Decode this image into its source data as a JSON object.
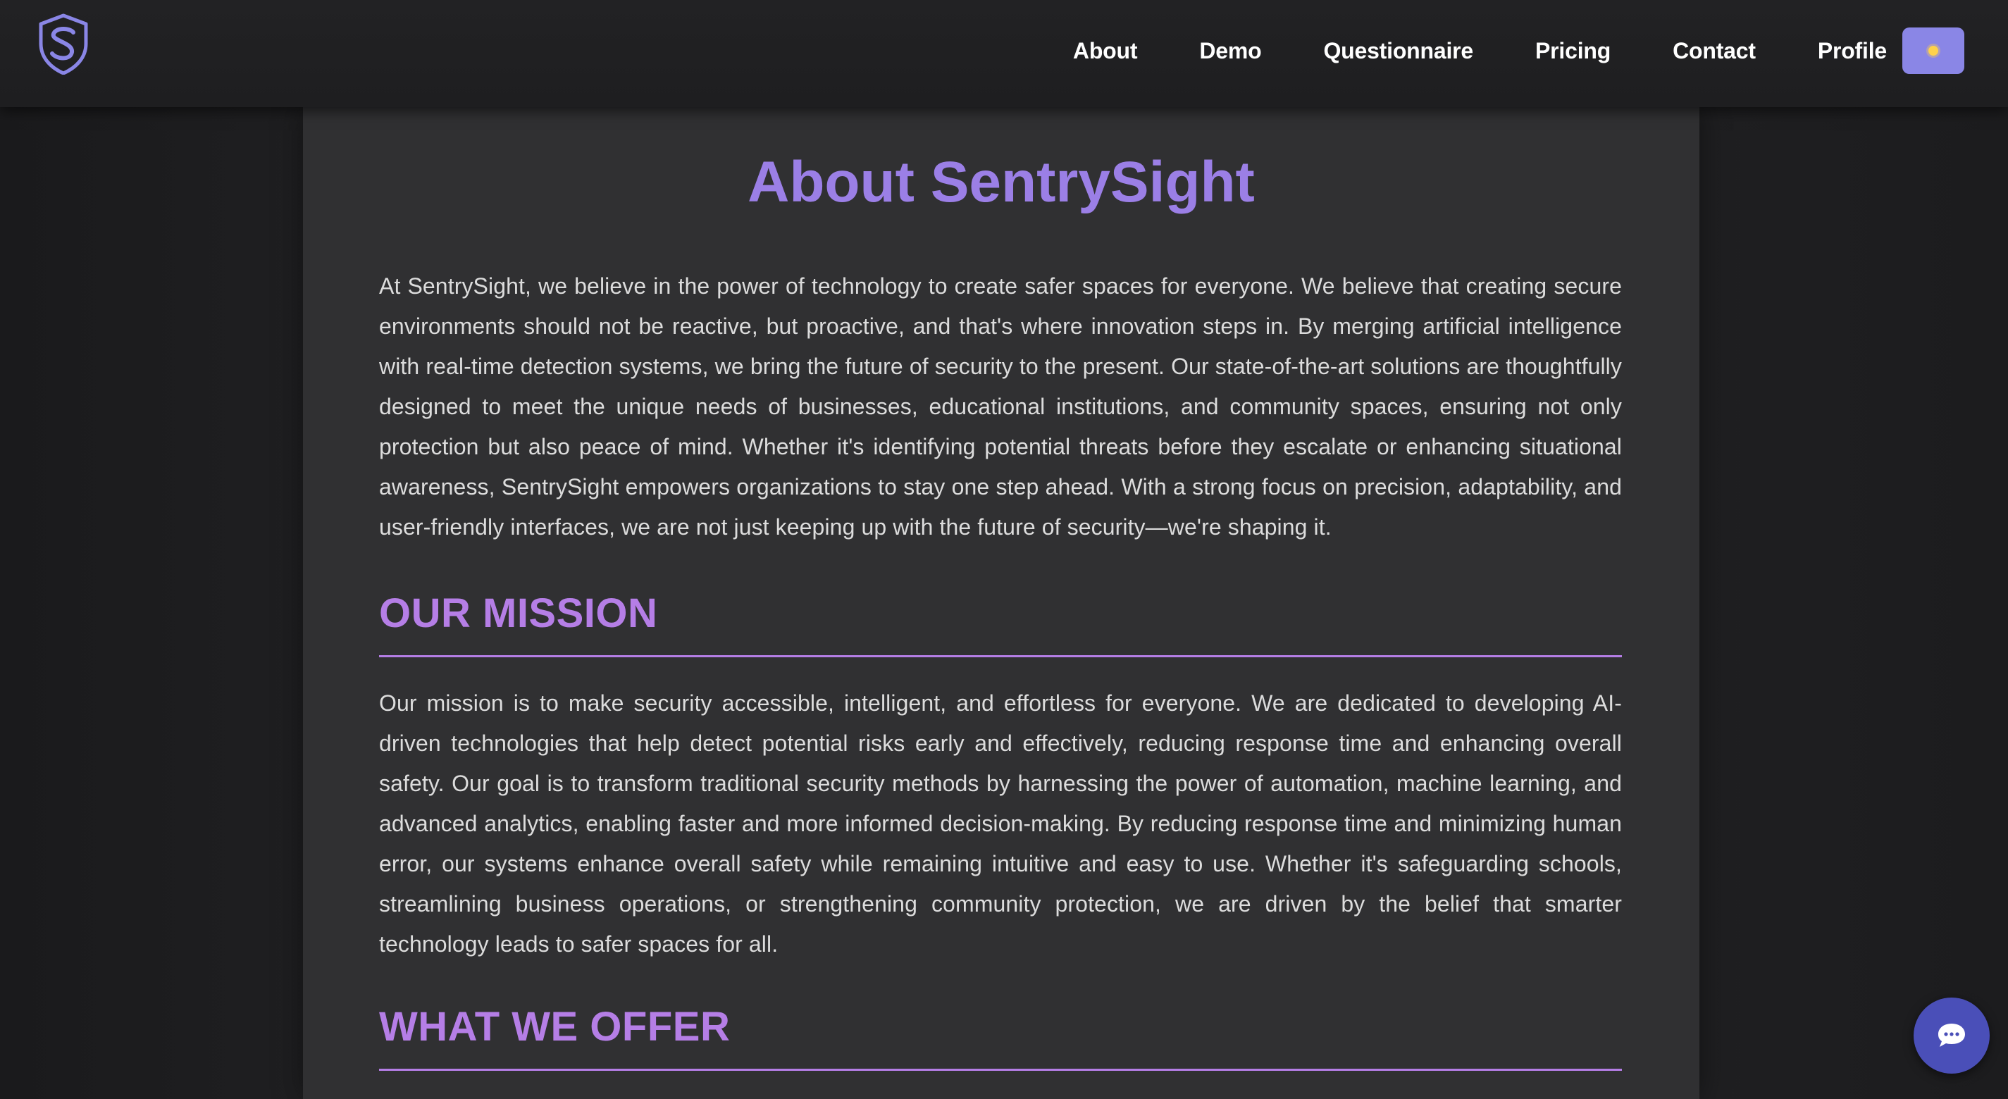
{
  "header": {
    "logo_icon": "shield-s-logo-icon",
    "nav": [
      {
        "label": "About"
      },
      {
        "label": "Demo"
      },
      {
        "label": "Questionnaire"
      },
      {
        "label": "Pricing"
      },
      {
        "label": "Contact"
      },
      {
        "label": "Profile"
      }
    ],
    "theme_toggle_icon": "sun-icon"
  },
  "main": {
    "title": "About SentrySight",
    "intro": "At SentrySight, we believe in the power of technology to create safer spaces for everyone. We believe that creating secure environments should not be reactive, but proactive, and that's where innovation steps in. By merging artificial intelligence with real-time detection systems, we bring the future of security to the present. Our state-of-the-art solutions are thoughtfully designed to meet the unique needs of businesses, educational institutions, and community spaces, ensuring not only protection but also peace of mind. Whether it's identifying potential threats before they escalate or enhancing situational awareness, SentrySight empowers organizations to stay one step ahead. With a strong focus on precision, adaptability, and user-friendly interfaces, we are not just keeping up with the future of security—we're shaping it.",
    "mission_heading": "OUR MISSION",
    "mission_text": "Our mission is to make security accessible, intelligent, and effortless for everyone. We are dedicated to developing AI-driven technologies that help detect potential risks early and effectively, reducing response time and enhancing overall safety. Our goal is to transform traditional security methods by harnessing the power of automation, machine learning, and advanced analytics, enabling faster and more informed decision-making. By reducing response time and minimizing human error, our systems enhance overall safety while remaining intuitive and easy to use. Whether it's safeguarding schools, streamlining business operations, or strengthening community protection, we are driven by the belief that smarter technology leads to safer spaces for all.",
    "offer_heading": "WHAT WE OFFER"
  },
  "chat": {
    "icon": "chat-bubble-icon"
  },
  "colors": {
    "title": "#9b7fe6",
    "section_heading": "#b57ee6",
    "toggle_bg": "#8a86e6",
    "chat_bg": "#4a4fb8",
    "panel_bg": "#303032",
    "page_bg": "#1f1f21"
  }
}
